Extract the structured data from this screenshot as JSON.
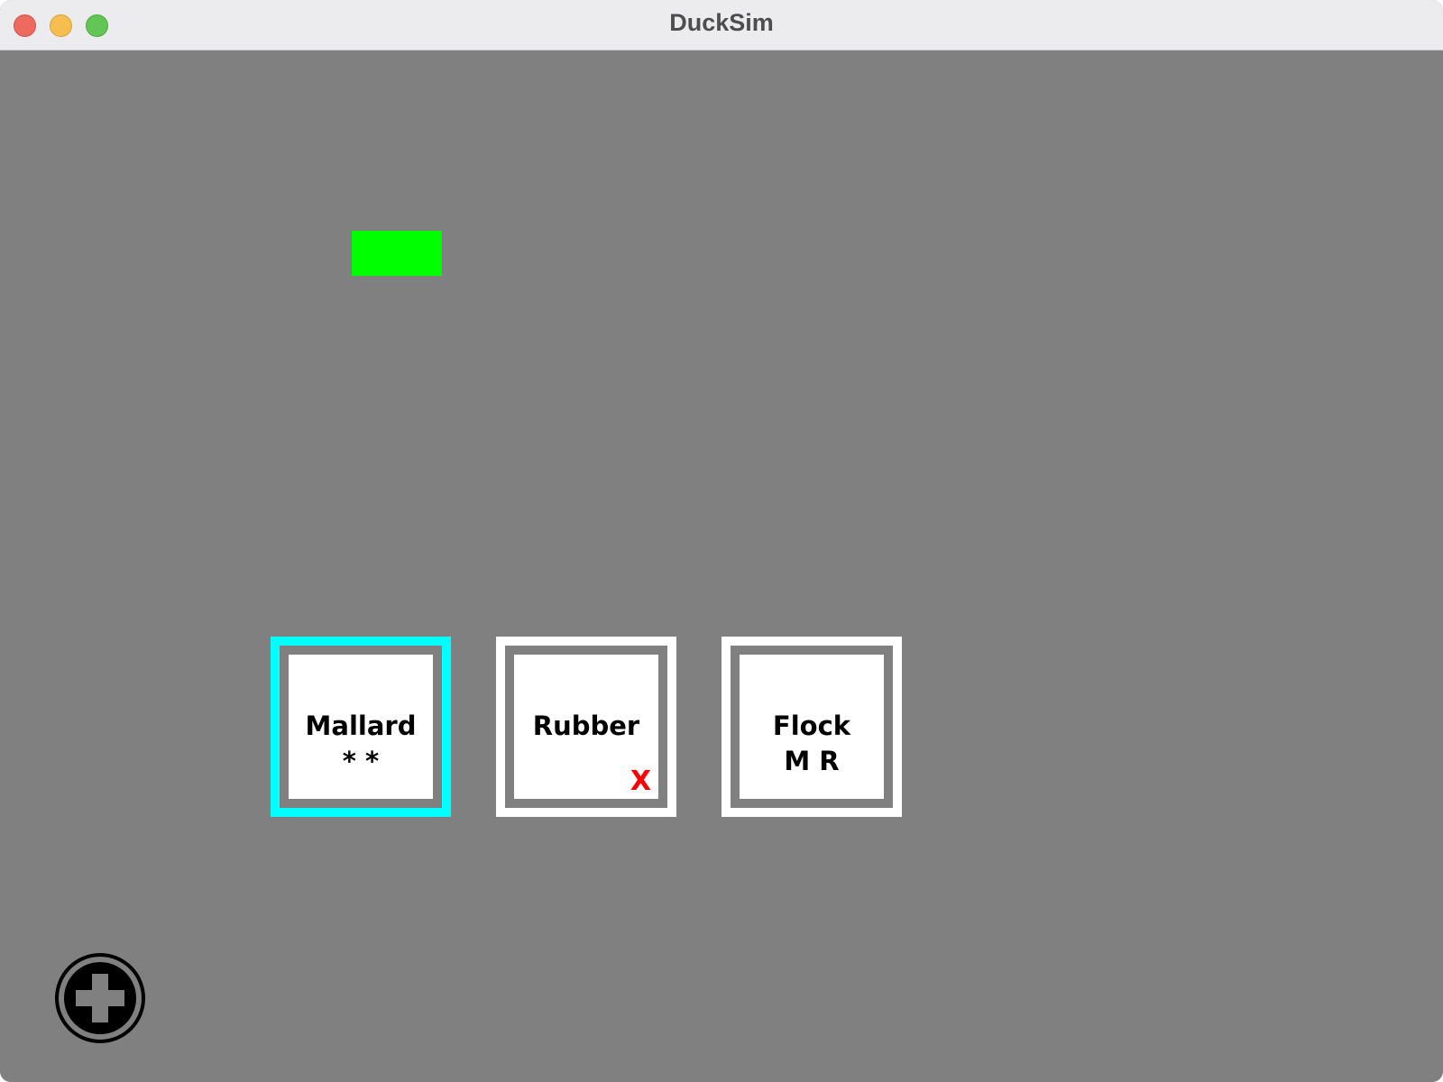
{
  "window": {
    "title": "DuckSim"
  },
  "cards": [
    {
      "name": "Mallard",
      "sub": "* *",
      "flag": "",
      "selected": true
    },
    {
      "name": "Rubber",
      "sub": "",
      "flag": "X",
      "selected": false
    },
    {
      "name": "Flock",
      "sub": "M R",
      "flag": "",
      "selected": false
    }
  ],
  "icons": {
    "add": "add-circle-icon"
  },
  "colors": {
    "background": "#808080",
    "titlebar": "#ececee",
    "block": "#00ff00",
    "selected_border": "#00ffff",
    "card_border": "#ffffff",
    "flag": "#ff0000"
  }
}
